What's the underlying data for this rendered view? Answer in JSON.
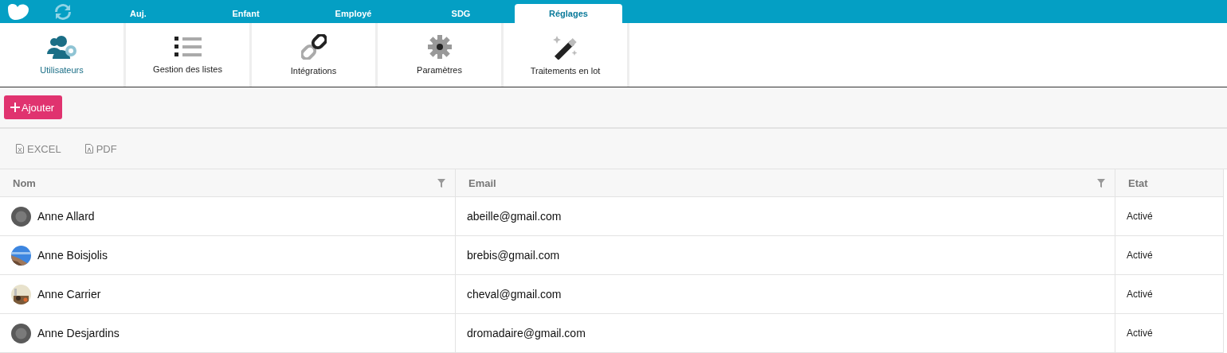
{
  "tabs": [
    {
      "label": "Auj.",
      "selected": false
    },
    {
      "label": "Enfant",
      "selected": false
    },
    {
      "label": "Employé",
      "selected": false
    },
    {
      "label": "SDG",
      "selected": false
    },
    {
      "label": "Réglages",
      "selected": true
    }
  ],
  "tiles": [
    {
      "label": "Utilisateurs",
      "kind": "users",
      "selected": true
    },
    {
      "label": "Gestion des listes",
      "kind": "list",
      "selected": false
    },
    {
      "label": "Intégrations",
      "kind": "link",
      "selected": false
    },
    {
      "label": "Paramètres",
      "kind": "gear",
      "selected": false
    },
    {
      "label": "Traitements en lot",
      "kind": "wand",
      "selected": false
    }
  ],
  "add_button": {
    "label": "Ajouter"
  },
  "exports": [
    {
      "label": "EXCEL",
      "kind": "excel"
    },
    {
      "label": "PDF",
      "kind": "pdf"
    }
  ],
  "table": {
    "columns": [
      {
        "label": "Nom",
        "filter": true
      },
      {
        "label": "Email",
        "filter": true
      },
      {
        "label": "Etat",
        "filter": false
      }
    ],
    "rows": [
      {
        "name": "Anne Allard",
        "avatar": {
          "kind": "default"
        },
        "email": "abeille@gmail.com",
        "status": "Activé"
      },
      {
        "name": "Anne Boisjolis",
        "email": "brebis@gmail.com",
        "status": "Activé"
      },
      {
        "name": "Anne Carrier",
        "email": "cheval@gmail.com",
        "status": "Activé"
      },
      {
        "name": "Anne Desjardins",
        "avatar": {
          "kind": "default"
        },
        "email": "dromadaire@gmail.com",
        "status": "Activé"
      }
    ]
  }
}
